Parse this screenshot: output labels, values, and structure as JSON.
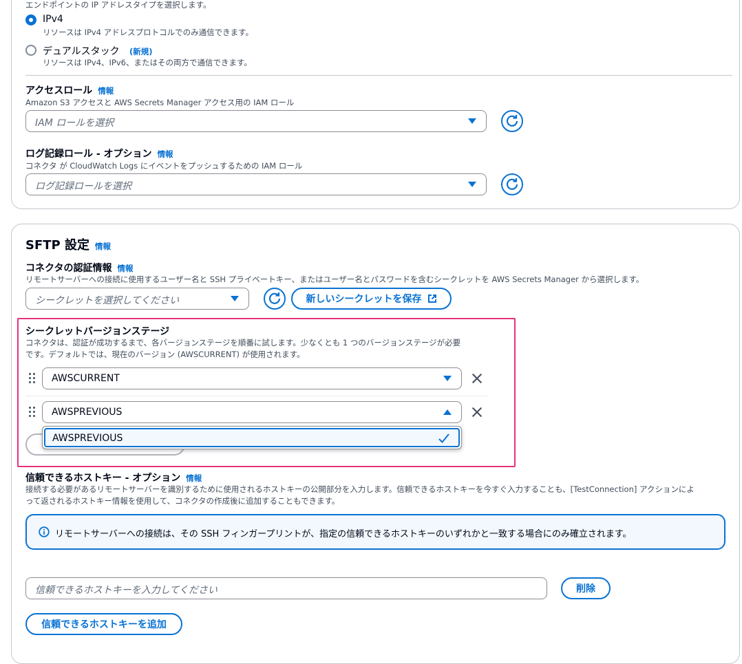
{
  "network": {
    "ip_type_description": "エンドポイントの IP アドレスタイプを選択します。",
    "ipv4": {
      "label": "IPv4",
      "description": "リソースは IPv4 アドレスプロトコルでのみ通信できます。"
    },
    "dualstack": {
      "label": "デュアルスタック",
      "badge": "(新規)",
      "description": "リソースは IPv4、IPv6、またはその両方で通信できます。"
    }
  },
  "access_role": {
    "label": "アクセスロール",
    "info": "情報",
    "description": "Amazon S3 アクセスと AWS Secrets Manager アクセス用の IAM ロール",
    "placeholder": "IAM ロールを選択"
  },
  "logging_role": {
    "label": "ログ記録ロール - オプション",
    "info": "情報",
    "description": "コネクタ が CloudWatch Logs にイベントをプッシュするための IAM ロール",
    "placeholder": "ログ記録ロールを選択"
  },
  "sftp": {
    "title": "SFTP 設定",
    "info": "情報",
    "credentials": {
      "label": "コネクタの認証情報",
      "info": "情報",
      "description": "リモートサーバーへの接続に使用するユーザー名と SSH プライベートキー、またはユーザー名とパスワードを含むシークレットを AWS Secrets Manager から選択します。",
      "placeholder": "シークレットを選択してください",
      "save_button": "新しいシークレットを保存"
    },
    "version_stage": {
      "label": "シークレットバージョンステージ",
      "description_line1": "コネクタは、認証が成功するまで、各バージョンステージを順番に試します。少なくとも 1 つのバージョンステージが必要",
      "description_line2": "です。デフォルトでは、現在のバージョン (AWSCURRENT) が使用されます。",
      "stage1": "AWSCURRENT",
      "stage2": "AWSPREVIOUS",
      "dropdown_option": "AWSPREVIOUS"
    },
    "host_key": {
      "label": "信頼できるホストキー - オプション",
      "info": "情報",
      "description_line1": "接続する必要があるリモートサーバーを識別するために使用されるホストキーの公開部分を入力します。信頼できるホストキーを今すぐ入力することも、[TestConnection] アクションによ",
      "description_line2": "って返されるホストキー情報を使用して、コネクタの作成後に追加することもできます。",
      "alert": "リモートサーバーへの接続は、その SSH フィンガープリントが、指定の信頼できるホストキーのいずれかと一致する場合にのみ確立されます。",
      "placeholder": "信頼できるホストキーを入力してください",
      "delete_button": "削除",
      "add_button": "信頼できるホストキーを追加"
    }
  },
  "colors": {
    "accent": "#0972d3",
    "highlight": "#e7317d"
  }
}
